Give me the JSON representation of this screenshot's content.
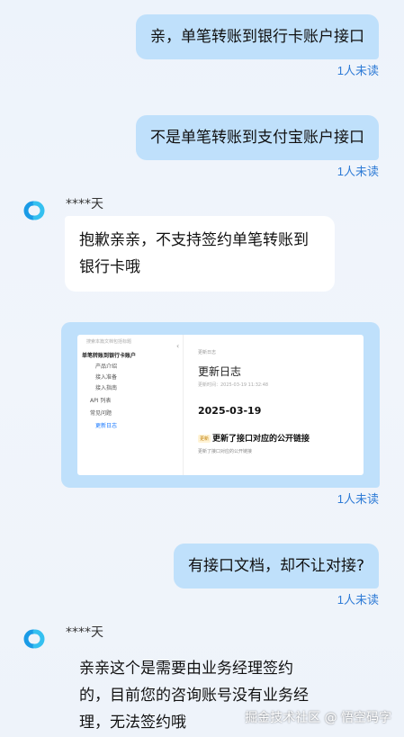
{
  "messages": {
    "m1": {
      "text": "亲，单笔转账到银行卡账户接口",
      "status": "1人未读"
    },
    "m2": {
      "text": "不是单笔转账到支付宝账户接口",
      "status": "1人未读"
    },
    "m3": {
      "sender": "****天",
      "lines": [
        "抱歉亲亲，不支持签约单笔转账到",
        "银行卡哦"
      ]
    },
    "m4": {
      "status": "1人未读"
    },
    "m5": {
      "text": "有接口文档，却不让对接?",
      "status": "1人未读"
    },
    "m6": {
      "sender": "****天",
      "lines": [
        "亲亲这个是需要由业务经理签约",
        "的，目前您的咨询账号没有业务经",
        "理，无法签约哦"
      ]
    }
  },
  "screenshot": {
    "search_placeholder": "搜索本篇文档包括标题",
    "nav": [
      "单笔转账到银行卡账户",
      "产品介绍",
      "接入准备",
      "接入指南",
      "API 列表",
      "常见问题",
      "更新日志"
    ],
    "breadcrumb": "更新日志",
    "page_title": "更新日志",
    "meta": "更新时间：2025-03-19 11:32:48",
    "date": "2025-03-19",
    "badge": "更新",
    "entry_title": "更新了接口对应的公开链接",
    "entry_desc": "更新了接口对应的公开链接"
  },
  "watermark": "掘金技术社区 @ 悟空码字"
}
